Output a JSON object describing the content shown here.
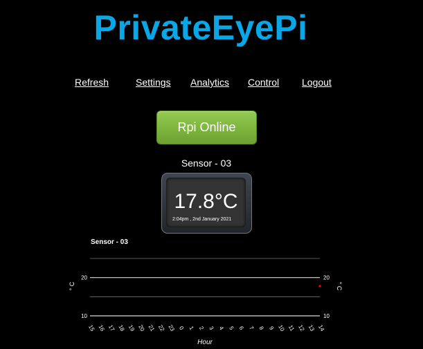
{
  "app": {
    "logo": "PrivateEyePi"
  },
  "nav": {
    "refresh": "Refresh",
    "settings": "Settings",
    "analytics": "Analytics",
    "control": "Control",
    "logout": "Logout"
  },
  "status": {
    "label": "Rpi Online",
    "color": "#7db43c"
  },
  "sensor": {
    "title": "Sensor - 03",
    "temperature": "17.8°C",
    "timestamp": "2:04pm , 2nd January 2021"
  },
  "chart_data": {
    "type": "scatter",
    "title": "Sensor - 03",
    "xlabel": "Hour",
    "ylabel": "° C",
    "categories": [
      "15",
      "16",
      "17",
      "18",
      "19",
      "20",
      "21",
      "22",
      "23",
      "0",
      "1",
      "2",
      "3",
      "4",
      "5",
      "6",
      "7",
      "8",
      "9",
      "10",
      "11",
      "12",
      "13",
      "14"
    ],
    "y_ticks": [
      10,
      20
    ],
    "ylim": [
      10,
      25
    ],
    "grid": true,
    "series": [
      {
        "color": "#ff0000",
        "points": [
          {
            "x": "14",
            "y": 17.8
          }
        ]
      }
    ]
  }
}
